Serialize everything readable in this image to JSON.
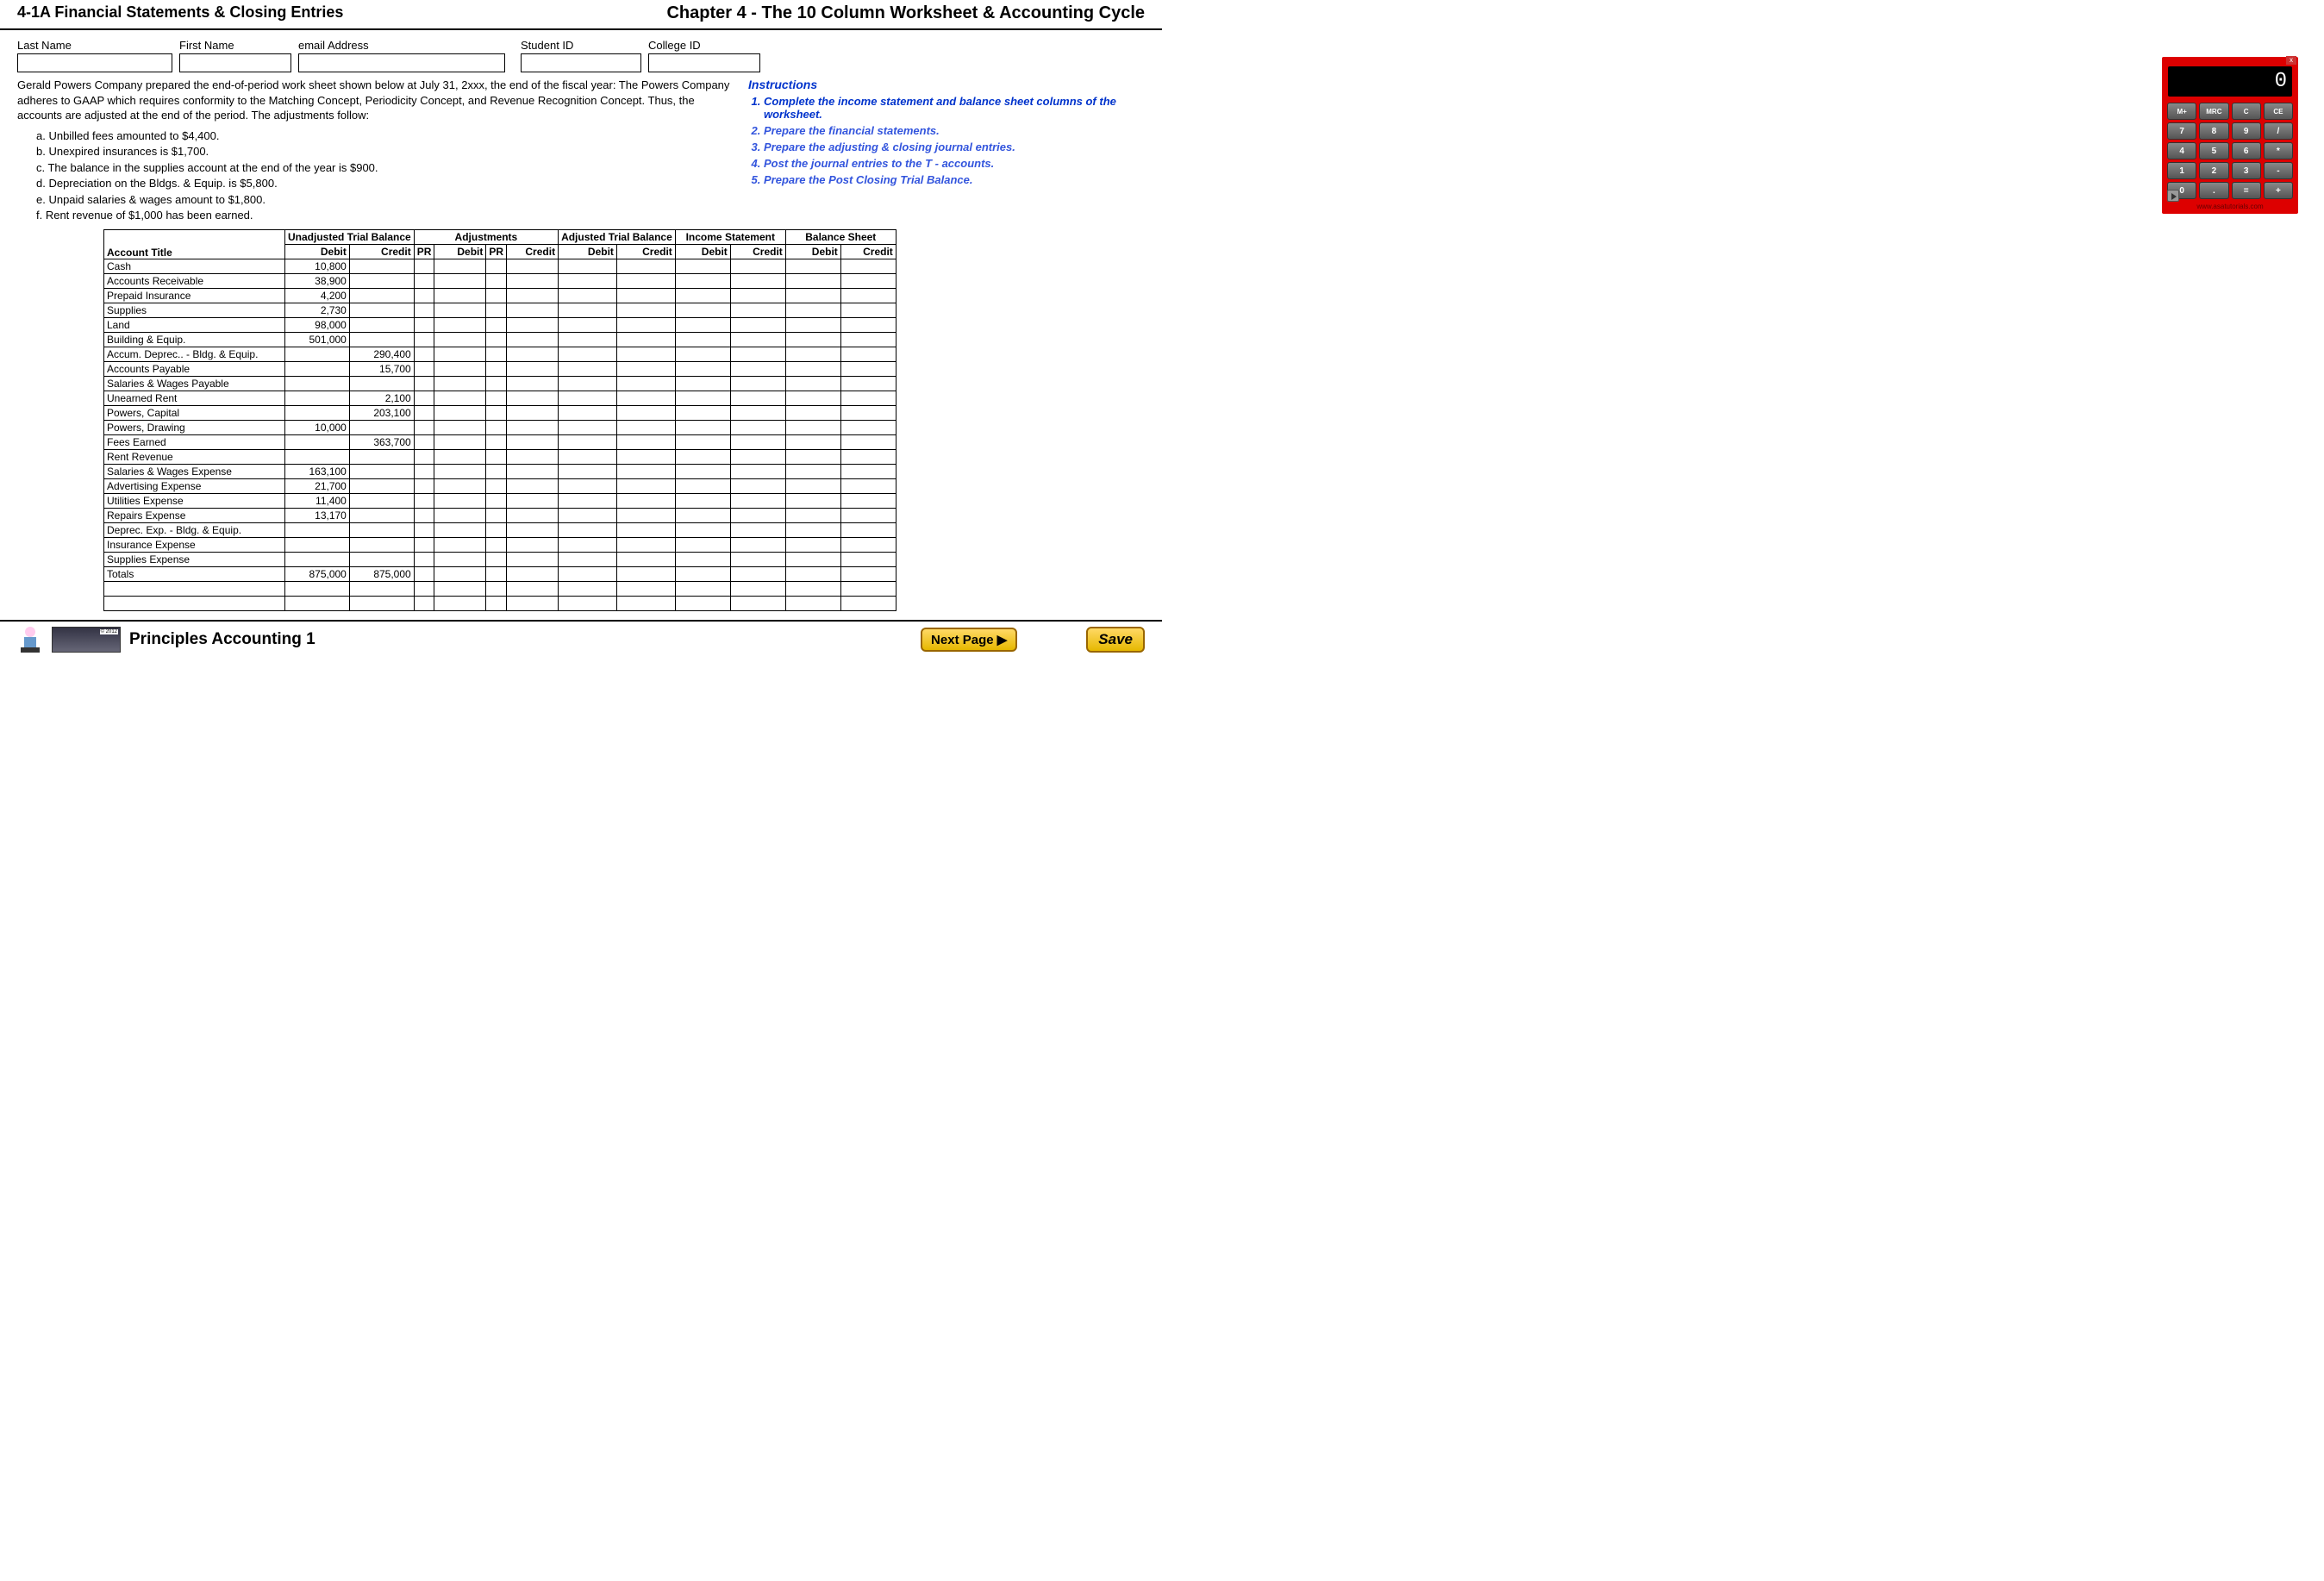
{
  "header": {
    "left": "4-1A  Financial Statements & Closing Entries",
    "right": "Chapter 4 - The 10 Column Worksheet & Accounting Cycle"
  },
  "fields": {
    "lastName": "Last Name",
    "firstName": "First Name",
    "email": "email Address",
    "studentId": "Student ID",
    "collegeId": "College ID"
  },
  "problem": {
    "intro": "Gerald Powers Company prepared the end-of-period work sheet shown below at July 31, 2xxx, the end of the fiscal year:  The Powers Company adheres to GAAP which requires conformity to the Matching Concept, Periodicity Concept, and Revenue Recognition Concept.  Thus, the accounts are adjusted at the end of the period.  The adjustments follow:",
    "adjustments": [
      "a.  Unbilled fees amounted to $4,400.",
      "b.  Unexpired insurances is $1,700.",
      "c.  The balance in the supplies account at the end of the year is $900.",
      "d.  Depreciation on the Bldgs. & Equip. is $5,800.",
      "e.  Unpaid salaries & wages amount to $1,800.",
      "f.   Rent revenue of $1,000 has been earned."
    ]
  },
  "instructions": {
    "title": "Instructions",
    "items": [
      "Complete the income statement and balance sheet columns of the worksheet.",
      "Prepare the financial statements.",
      "Prepare the adjusting & closing journal entries.",
      "Post the journal entries to the T - accounts.",
      "Prepare the Post Closing Trial Balance."
    ]
  },
  "worksheet": {
    "groups": [
      "Unadjusted Trial Balance",
      "Adjustments",
      "Adjusted Trial Balance",
      "Income Statement",
      "Balance Sheet"
    ],
    "subheads": {
      "acct": "Account Title",
      "dr": "Debit",
      "cr": "Credit",
      "pr": "PR"
    },
    "rows": [
      {
        "t": "Cash",
        "utd": "10,800",
        "utc": ""
      },
      {
        "t": "Accounts Receivable",
        "utd": "38,900",
        "utc": ""
      },
      {
        "t": "Prepaid Insurance",
        "utd": "4,200",
        "utc": ""
      },
      {
        "t": "Supplies",
        "utd": "2,730",
        "utc": ""
      },
      {
        "t": "Land",
        "utd": "98,000",
        "utc": ""
      },
      {
        "t": "Building & Equip.",
        "utd": "501,000",
        "utc": ""
      },
      {
        "t": "Accum. Deprec.. - Bldg. & Equip.",
        "utd": "",
        "utc": "290,400"
      },
      {
        "t": "Accounts Payable",
        "utd": "",
        "utc": "15,700"
      },
      {
        "t": "Salaries & Wages Payable",
        "utd": "",
        "utc": ""
      },
      {
        "t": "Unearned Rent",
        "utd": "",
        "utc": "2,100"
      },
      {
        "t": "Powers, Capital",
        "utd": "",
        "utc": "203,100"
      },
      {
        "t": "Powers, Drawing",
        "utd": "10,000",
        "utc": ""
      },
      {
        "t": "Fees Earned",
        "utd": "",
        "utc": "363,700"
      },
      {
        "t": "Rent Revenue",
        "utd": "",
        "utc": ""
      },
      {
        "t": "Salaries & Wages Expense",
        "utd": "163,100",
        "utc": ""
      },
      {
        "t": "Advertising Expense",
        "utd": "21,700",
        "utc": ""
      },
      {
        "t": "Utilities Expense",
        "utd": "11,400",
        "utc": ""
      },
      {
        "t": "Repairs Expense",
        "utd": "13,170",
        "utc": ""
      },
      {
        "t": "Deprec. Exp. - Bldg. & Equip.",
        "utd": "",
        "utc": ""
      },
      {
        "t": "Insurance Expense",
        "utd": "",
        "utc": ""
      },
      {
        "t": "Supplies Expense",
        "utd": "",
        "utc": ""
      },
      {
        "t": "Totals",
        "utd": "875,000",
        "utc": "875,000"
      }
    ]
  },
  "calc": {
    "display": "0",
    "url": "www.asatutorials.com",
    "buttons": [
      "M+",
      "MRC",
      "C",
      "CE",
      "7",
      "8",
      "9",
      "/",
      "4",
      "5",
      "6",
      "*",
      "1",
      "2",
      "3",
      "-",
      "0",
      ".",
      "=",
      "+"
    ]
  },
  "footer": {
    "title": "Principles Accounting 1",
    "next": "Next Page ▶",
    "save": "Save"
  }
}
